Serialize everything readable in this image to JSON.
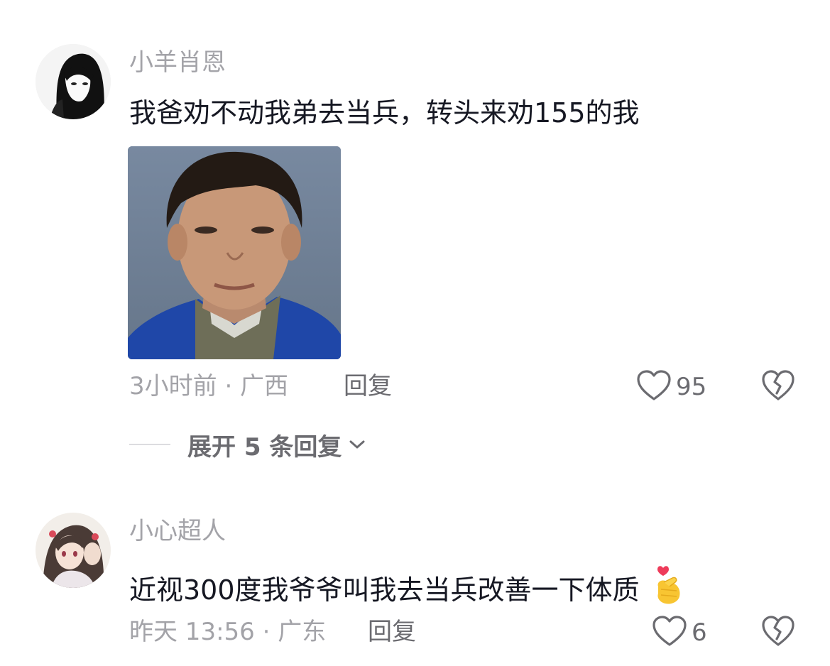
{
  "comments": [
    {
      "username": "小羊肖恩",
      "text": "我爸劝不动我弟去当兵，转头来劝155的我",
      "meta": "3小时前 · 广西",
      "reply_label": "回复",
      "like_count": "95",
      "expand_label": "展开 5 条回复",
      "has_image": true
    },
    {
      "username": "小心超人",
      "text": "近视300度我爷爷叫我去当兵改善一下体质",
      "emoji": "🫰",
      "meta": "昨天 13:56 · 广东",
      "reply_label": "回复",
      "like_count": "6"
    }
  ],
  "colors": {
    "meta": "#a3a3a8",
    "action": "#6b6b70",
    "text": "#161823"
  }
}
